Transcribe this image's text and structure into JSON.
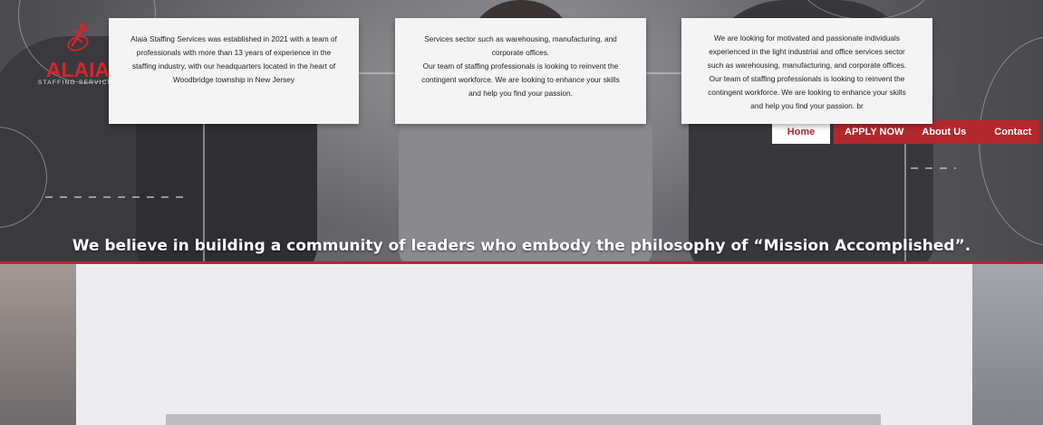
{
  "brand": {
    "name": "ALAIA",
    "tagline": "STAFFING SERVICES",
    "accent_color": "#b3282d"
  },
  "nav": {
    "items": [
      {
        "label": "Home",
        "active": true
      },
      {
        "label": "APPLY NOW",
        "active": false
      },
      {
        "label": "About Us",
        "active": false
      },
      {
        "label": "Contact",
        "active": false
      }
    ]
  },
  "hero": {
    "headline": "We believe in building a community of leaders who embody the philosophy of “Mission Accomplished”."
  },
  "cards": [
    {
      "lines": [
        "Alaia Staffing Services was established in 2021 with a team of",
        "professionals with more than 13 years of experience in the",
        "staffing industry, with our headquarters located in the heart of",
        "Woodbridge township in New Jersey"
      ]
    },
    {
      "lines": [
        "Services sector such as warehousing, manufacturing, and",
        "corporate offices.",
        "Our team of staffing professionals is looking to reinvent the",
        "contingent workforce. We are looking to enhance your skills",
        "and help you find your passion."
      ]
    },
    {
      "lines": [
        "We are looking for motivated and passionate individuals",
        "experienced in the light industrial and office services sector",
        "such as warehousing, manufacturing, and corporate offices.",
        "Our team of staffing professionals is looking to reinvent the",
        "contingent workforce. We are looking to enhance your skills",
        "and help you find your passion. br"
      ]
    }
  ]
}
